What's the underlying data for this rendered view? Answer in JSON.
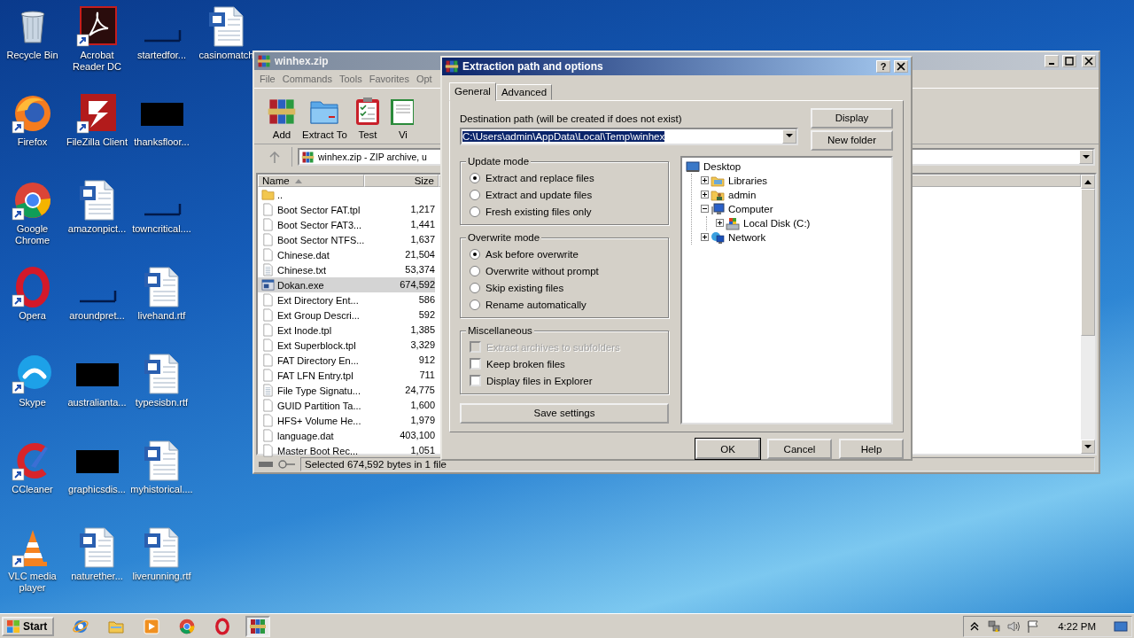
{
  "desktop_icons": [
    {
      "label": "Recycle Bin",
      "kind": "bin",
      "shortcut": false
    },
    {
      "label": "Firefox",
      "kind": "firefox",
      "shortcut": true
    },
    {
      "label": "Google Chrome",
      "kind": "chrome",
      "shortcut": true
    },
    {
      "label": "Opera",
      "kind": "opera",
      "shortcut": true
    },
    {
      "label": "Skype",
      "kind": "skype",
      "shortcut": true
    },
    {
      "label": "CCleaner",
      "kind": "ccleaner",
      "shortcut": true
    },
    {
      "label": "VLC media player",
      "kind": "vlc",
      "shortcut": true
    },
    {
      "label": "Acrobat Reader DC",
      "kind": "pdf",
      "shortcut": true
    },
    {
      "label": "FileZilla Client",
      "kind": "ftp",
      "shortcut": true
    },
    {
      "label": "amazonpict...",
      "kind": "doc",
      "shortcut": false
    },
    {
      "label": "aroundpret...",
      "kind": "blank",
      "shortcut": false
    },
    {
      "label": "australianta...",
      "kind": "black",
      "shortcut": false
    },
    {
      "label": "graphicsdis...",
      "kind": "black",
      "shortcut": false
    },
    {
      "label": "naturether...",
      "kind": "doc",
      "shortcut": false
    },
    {
      "label": "startedfor...",
      "kind": "blank",
      "shortcut": false
    },
    {
      "label": "thanksfloor...",
      "kind": "black",
      "shortcut": false
    },
    {
      "label": "towncritical....",
      "kind": "blank",
      "shortcut": false
    },
    {
      "label": "livehand.rtf",
      "kind": "doc",
      "shortcut": false
    },
    {
      "label": "typesisbn.rtf",
      "kind": "doc",
      "shortcut": false
    },
    {
      "label": "myhistorical....",
      "kind": "doc",
      "shortcut": false
    },
    {
      "label": "liverunning.rtf",
      "kind": "doc",
      "shortcut": false
    },
    {
      "label": "casinomatch",
      "kind": "doc",
      "shortcut": false
    }
  ],
  "main_window": {
    "title": "winhex.zip",
    "menu": [
      "File",
      "Commands",
      "Tools",
      "Favorites",
      "Opt"
    ],
    "toolbar": [
      {
        "label": "Add",
        "kind": "add"
      },
      {
        "label": "Extract To",
        "kind": "extract"
      },
      {
        "label": "Test",
        "kind": "test"
      },
      {
        "label": "Vi",
        "kind": "view"
      }
    ],
    "address": "winhex.zip - ZIP archive, u",
    "columns": [
      {
        "label": "Name",
        "sorted": true
      },
      {
        "label": "Size",
        "sorted": false
      }
    ],
    "rows": [
      {
        "name": "..",
        "size": "",
        "kind": "folder",
        "selected": false
      },
      {
        "name": "Boot Sector FAT.tpl",
        "size": "1,217",
        "kind": "file",
        "selected": false
      },
      {
        "name": "Boot Sector FAT3...",
        "size": "1,441",
        "kind": "file",
        "selected": false
      },
      {
        "name": "Boot Sector NTFS...",
        "size": "1,637",
        "kind": "file",
        "selected": false
      },
      {
        "name": "Chinese.dat",
        "size": "21,504",
        "kind": "file",
        "selected": false
      },
      {
        "name": "Chinese.txt",
        "size": "53,374",
        "kind": "text",
        "selected": false
      },
      {
        "name": "Dokan.exe",
        "size": "674,592",
        "kind": "exe",
        "selected": true
      },
      {
        "name": "Ext Directory Ent...",
        "size": "586",
        "kind": "file",
        "selected": false
      },
      {
        "name": "Ext Group Descri...",
        "size": "592",
        "kind": "file",
        "selected": false
      },
      {
        "name": "Ext Inode.tpl",
        "size": "1,385",
        "kind": "file",
        "selected": false
      },
      {
        "name": "Ext Superblock.tpl",
        "size": "3,329",
        "kind": "file",
        "selected": false
      },
      {
        "name": "FAT Directory En...",
        "size": "912",
        "kind": "file",
        "selected": false
      },
      {
        "name": "FAT LFN Entry.tpl",
        "size": "711",
        "kind": "file",
        "selected": false
      },
      {
        "name": "File Type Signatu...",
        "size": "24,775",
        "kind": "text",
        "selected": false
      },
      {
        "name": "GUID Partition Ta...",
        "size": "1,600",
        "kind": "file",
        "selected": false
      },
      {
        "name": "HFS+ Volume He...",
        "size": "1,979",
        "kind": "file",
        "selected": false
      },
      {
        "name": "language.dat",
        "size": "403,100",
        "kind": "file",
        "selected": false
      },
      {
        "name": "Master Boot Rec...",
        "size": "1,051",
        "kind": "file",
        "selected": false
      }
    ],
    "status": "Selected 674,592 bytes in 1 file"
  },
  "dialog": {
    "title": "Extraction path and options",
    "help_button": "?",
    "tabs": [
      {
        "label": "General",
        "selected": true
      },
      {
        "label": "Advanced",
        "selected": false
      }
    ],
    "destination": {
      "label": "Destination path (will be created if does not exist)",
      "value": "C:\\Users\\admin\\AppData\\Local\\Temp\\winhex"
    },
    "side_buttons": [
      "Display",
      "New folder"
    ],
    "groups": [
      {
        "title": "Update mode",
        "kind": "radio",
        "options": [
          {
            "label": "Extract and replace files",
            "selected": true,
            "disabled": false
          },
          {
            "label": "Extract and update files",
            "selected": false,
            "disabled": false
          },
          {
            "label": "Fresh existing files only",
            "selected": false,
            "disabled": false
          }
        ]
      },
      {
        "title": "Overwrite mode",
        "kind": "radio",
        "options": [
          {
            "label": "Ask before overwrite",
            "selected": true,
            "disabled": false
          },
          {
            "label": "Overwrite without prompt",
            "selected": false,
            "disabled": false
          },
          {
            "label": "Skip existing files",
            "selected": false,
            "disabled": false
          },
          {
            "label": "Rename automatically",
            "selected": false,
            "disabled": false
          }
        ]
      },
      {
        "title": "Miscellaneous",
        "kind": "checkbox",
        "options": [
          {
            "label": "Extract archives to subfolders",
            "checked": false,
            "disabled": true
          },
          {
            "label": "Keep broken files",
            "checked": false,
            "disabled": false
          },
          {
            "label": "Display files in Explorer",
            "checked": false,
            "disabled": false
          }
        ]
      }
    ],
    "save_button": "Save settings",
    "tree": [
      {
        "label": "Desktop",
        "kind": "desktop",
        "children": [
          {
            "label": "Libraries",
            "kind": "libraries",
            "expanded": false
          },
          {
            "label": "admin",
            "kind": "user",
            "expanded": false
          },
          {
            "label": "Computer",
            "kind": "computer",
            "expanded": true,
            "children": [
              {
                "label": "Local Disk (C:)",
                "kind": "disk",
                "expanded": false
              }
            ]
          },
          {
            "label": "Network",
            "kind": "network",
            "expanded": false
          }
        ]
      }
    ],
    "buttons": [
      {
        "label": "OK",
        "default": true
      },
      {
        "label": "Cancel",
        "default": false
      },
      {
        "label": "Help",
        "default": false
      }
    ]
  },
  "taskbar": {
    "start": "Start",
    "apps": [
      {
        "kind": "ie",
        "selected": false
      },
      {
        "kind": "explorer",
        "selected": false
      },
      {
        "kind": "media",
        "selected": false
      },
      {
        "kind": "chrome",
        "selected": false
      },
      {
        "kind": "opera",
        "selected": false
      },
      {
        "kind": "winrar",
        "selected": true
      }
    ],
    "clock": "4:22 PM"
  }
}
